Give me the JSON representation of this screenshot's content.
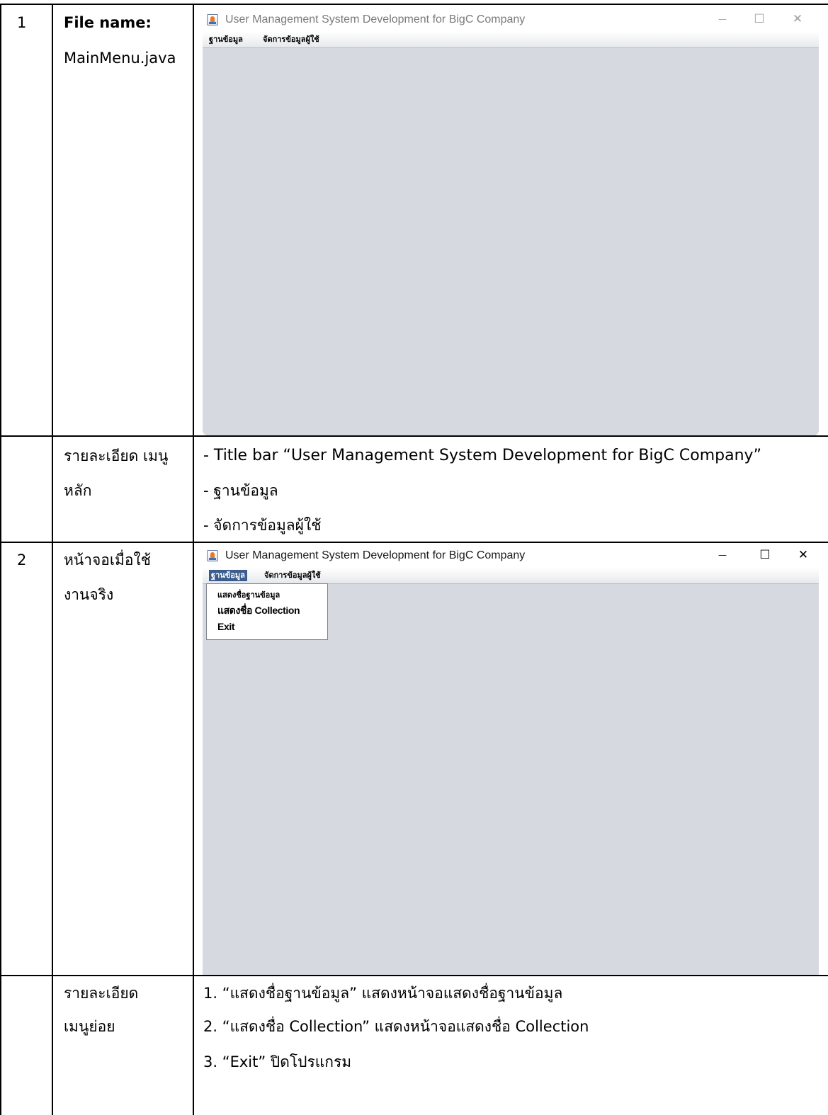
{
  "rows": [
    {
      "number": "1",
      "label_bold": "File name:",
      "label": "MainMenu.java",
      "window": {
        "title": "User Management System Development for BigC Company",
        "controls": [
          "—",
          "☐",
          "✕"
        ],
        "menus": [
          "ฐานข้อมูล",
          "จัดการข้อมูลผู้ใช้"
        ]
      }
    },
    {
      "number": "",
      "label_lines": [
        "รายละเอียด เมนู",
        "หลัก"
      ],
      "desc_lines": [
        "- Title bar “User Management System Development for BigC Company”",
        "- ฐานข้อมูล",
        "- จัดการข้อมูลผู้ใช้"
      ]
    },
    {
      "number": "2",
      "label_lines": [
        "หน้าจอเมื่อใช้",
        "งานจริง"
      ],
      "window": {
        "title": "User Management System Development for BigC Company",
        "controls": [
          "—",
          "☐",
          "✕"
        ],
        "menus": [
          "ฐานข้อมูล",
          "จัดการข้อมูลผู้ใช้"
        ],
        "active_menu": "ฐานข้อมูล",
        "dropdown_items": [
          "แสดงชื่อฐานข้อมูล",
          "แสดงชื่อ Collection",
          "Exit"
        ]
      }
    },
    {
      "number": "",
      "label_lines": [
        "รายละเอียด",
        "เมนูย่อย"
      ],
      "desc_lines": [
        "1. “แสดงชื่อฐานข้อมูล” แสดงหน้าจอแสดงชื่อฐานข้อมูล",
        "2. “แสดงชื่อ Collection” แสดงหน้าจอแสดงชื่อ Collection",
        "3. “Exit” ปิดโปรแกรม"
      ]
    }
  ]
}
